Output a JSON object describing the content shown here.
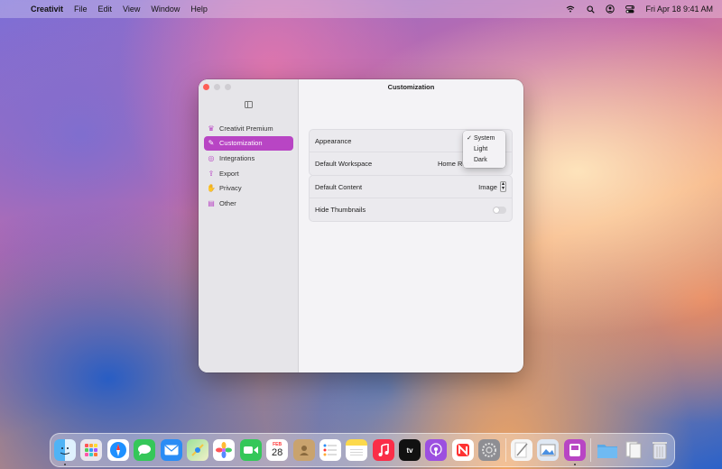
{
  "menubar": {
    "app_name": "Creativit",
    "menus": [
      "File",
      "Edit",
      "View",
      "Window",
      "Help"
    ],
    "datetime": "Fri Apr 18  9:41 AM"
  },
  "window": {
    "title": "Customization",
    "sidebar": {
      "items": [
        {
          "label": "Creativit Premium",
          "icon": "crown-icon",
          "glyph": "♛"
        },
        {
          "label": "Customization",
          "icon": "brush-icon",
          "glyph": "✎",
          "active": true
        },
        {
          "label": "Integrations",
          "icon": "link-icon",
          "glyph": "◎"
        },
        {
          "label": "Export",
          "icon": "export-icon",
          "glyph": "⇪"
        },
        {
          "label": "Privacy",
          "icon": "hand-icon",
          "glyph": "✋"
        },
        {
          "label": "Other",
          "icon": "document-icon",
          "glyph": "▤"
        }
      ]
    },
    "settings": {
      "appearance_label": "Appearance",
      "workspace_label": "Default Workspace",
      "workspace_value": "Home Reno",
      "content_label": "Default Content",
      "content_value": "Image",
      "thumbnails_label": "Hide Thumbnails",
      "thumbnails_on": false
    },
    "appearance_menu": {
      "options": [
        "System",
        "Light",
        "Dark"
      ],
      "selected": "System"
    }
  },
  "dock": {
    "calendar_month": "FEB",
    "calendar_day": "28",
    "apple_tv_label": "tv",
    "apps": [
      "Finder",
      "Launchpad",
      "Safari",
      "Messages",
      "Mail",
      "Maps",
      "Photos",
      "FaceTime",
      "Calendar",
      "Contacts",
      "Reminders",
      "Notes",
      "Music",
      "Apple TV",
      "Podcasts",
      "News",
      "System Settings",
      "TextEdit",
      "Preview",
      "Creativit",
      "Folder",
      "Documents",
      "Trash"
    ]
  },
  "colors": {
    "accent": "#b845c4"
  }
}
